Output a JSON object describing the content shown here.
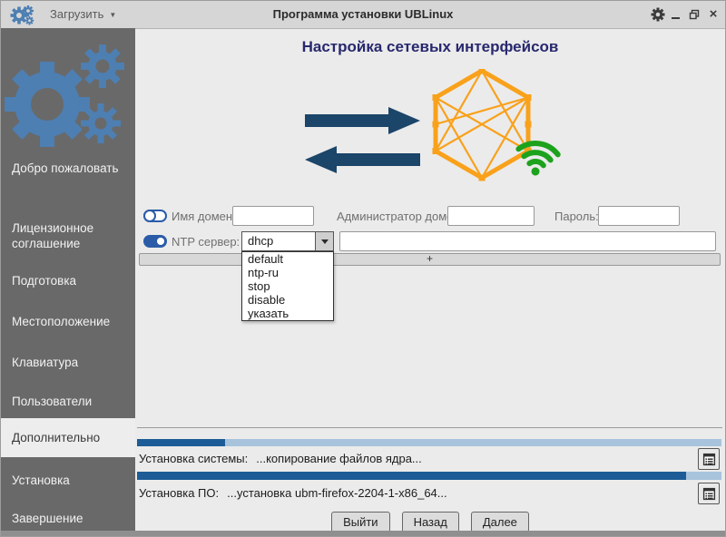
{
  "titlebar": {
    "menu_label": "Загрузить",
    "title": "Программа установки UBLinux"
  },
  "sidebar": {
    "items": [
      {
        "label": "Добро пожаловать",
        "active": false
      },
      {
        "label": "Лицензионное соглашение",
        "active": false
      },
      {
        "label": "Подготовка",
        "active": false
      },
      {
        "label": "Местоположение",
        "active": false
      },
      {
        "label": "Клавиатура",
        "active": false
      },
      {
        "label": "Пользователи",
        "active": false
      },
      {
        "label": "Дополнительно",
        "active": true
      },
      {
        "label": "Установка",
        "active": false
      },
      {
        "label": "Завершение",
        "active": false
      }
    ]
  },
  "main": {
    "heading": "Настройка сетевых интерфейсов",
    "form": {
      "domain_enabled": false,
      "domain_name_label": "Имя домена:",
      "domain_name_value": "",
      "domain_admin_label": "Администратор домена:",
      "domain_admin_value": "",
      "password_label": "Пароль:",
      "password_value": "",
      "ntp_enabled": true,
      "ntp_label": "NTP сервер:",
      "ntp_selected": "dhcp",
      "ntp_options": [
        "default",
        "ntp-ru",
        "stop",
        "disable",
        "указать"
      ],
      "ntp_custom_value": "",
      "add_button_label": "+"
    },
    "progress": {
      "system": {
        "label": "Установка системы:",
        "status": "...копирование файлов ядра...",
        "percent": 15
      },
      "software": {
        "label": "Установка ПО:",
        "status": "...установка ubm-firefox-2204-1-x86_64...",
        "percent": 94
      }
    },
    "buttons": {
      "exit": "Выйти",
      "back": "Назад",
      "next": "Далее"
    }
  },
  "colors": {
    "accent_blue": "#4d7fb2",
    "toggle_blue": "#2a5ca8",
    "progress_fill": "#1d5c96",
    "progress_track": "#a8c3dc",
    "arrow_navy": "#1b4569",
    "hexagon_orange": "#f9a11b",
    "wifi_green": "#1da21d",
    "heading_navy": "#28286e",
    "sidebar_gray": "#696969"
  }
}
